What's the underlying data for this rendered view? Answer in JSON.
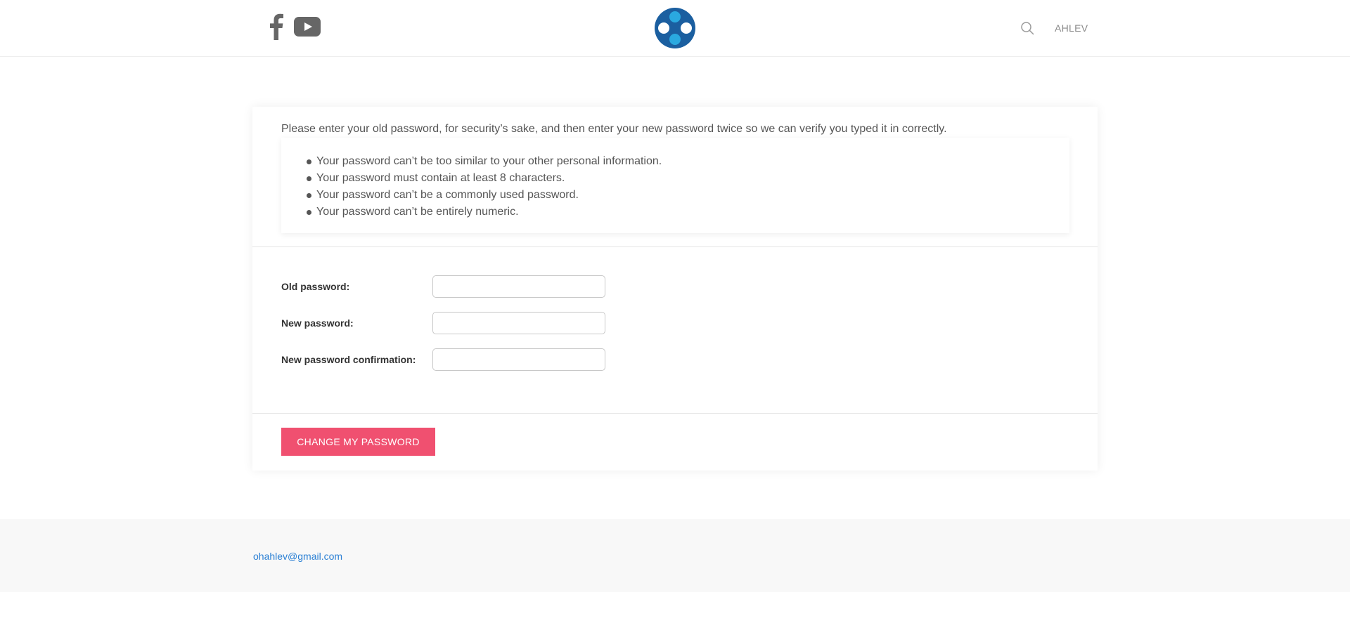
{
  "header": {
    "social": [
      "facebook-icon",
      "youtube-icon"
    ],
    "logo": "logo-circles",
    "search_icon": "search-icon",
    "user_label": "AHLEV"
  },
  "form": {
    "intro": "Please enter your old password, for security’s sake, and then enter your new password twice so we can verify you typed it in correctly.",
    "rules": [
      "Your password can’t be too similar to your other personal information.",
      "Your password must contain at least 8 characters.",
      "Your password can’t be a commonly used password.",
      "Your password can’t be entirely numeric."
    ],
    "fields": [
      {
        "label": "Old password:",
        "value": ""
      },
      {
        "label": "New password:",
        "value": ""
      },
      {
        "label": "New password confirmation:",
        "value": ""
      }
    ],
    "submit_label": "CHANGE MY PASSWORD"
  },
  "footer": {
    "email": "ohahlev@gmail.com"
  },
  "colors": {
    "accent": "#f05070",
    "logo_dark": "#1b5fa0",
    "logo_light": "#2aa9e0",
    "link": "#2a7fd4"
  }
}
